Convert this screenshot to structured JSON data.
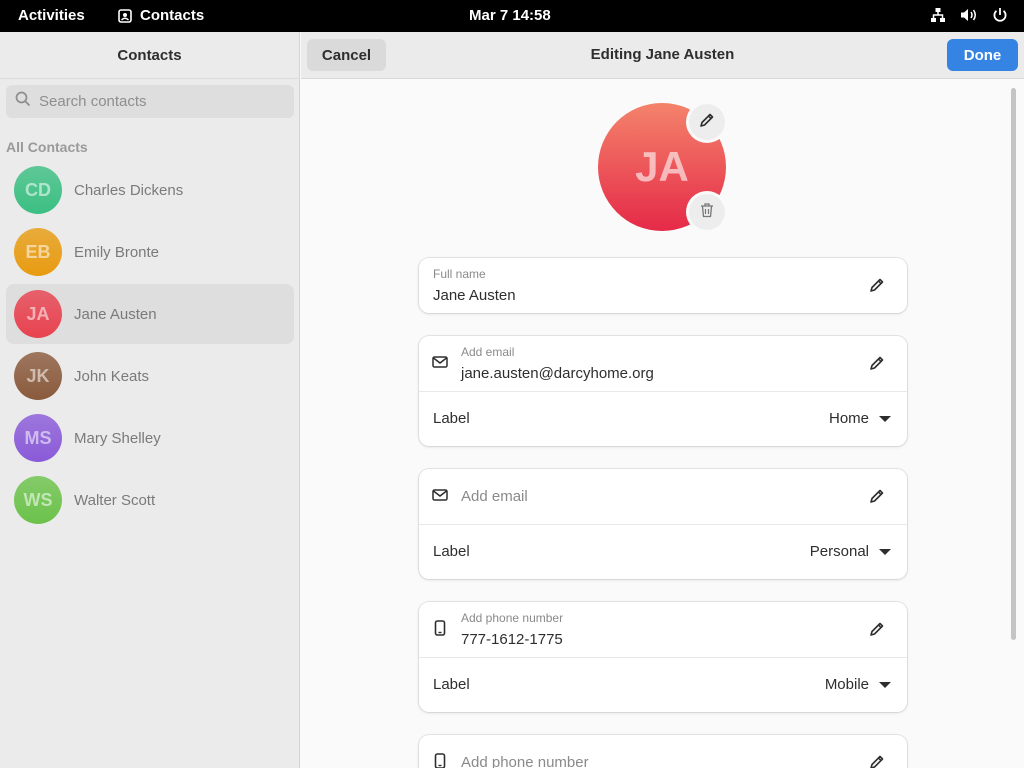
{
  "topbar": {
    "activities": "Activities",
    "app_name": "Contacts",
    "clock": "Mar 7  14:58",
    "icons": [
      "network-icon",
      "volume-icon",
      "power-icon"
    ]
  },
  "sidebar": {
    "title": "Contacts",
    "search_placeholder": "Search contacts",
    "section_label": "All Contacts",
    "contacts": [
      {
        "initials": "CD",
        "name": "Charles Dickens",
        "color": "#3bbf82",
        "selected": false
      },
      {
        "initials": "EB",
        "name": "Emily Bronte",
        "color": "#e89b10",
        "selected": false
      },
      {
        "initials": "JA",
        "name": "Jane Austen",
        "color": "#e8424f",
        "selected": true
      },
      {
        "initials": "JK",
        "name": "John Keats",
        "color": "#8a5a3c",
        "selected": false
      },
      {
        "initials": "MS",
        "name": "Mary Shelley",
        "color": "#8a5ad8",
        "selected": false
      },
      {
        "initials": "WS",
        "name": "Walter Scott",
        "color": "#6bc24a",
        "selected": false
      }
    ]
  },
  "header": {
    "cancel": "Cancel",
    "title": "Editing Jane Austen",
    "done": "Done"
  },
  "editor": {
    "avatar_initials": "JA",
    "full_name": {
      "label": "Full name",
      "value": "Jane Austen"
    },
    "email1": {
      "label": "Add email",
      "value": "jane.austen@darcyhome.org",
      "type_label": "Label",
      "type_value": "Home"
    },
    "email2": {
      "placeholder": "Add email",
      "type_label": "Label",
      "type_value": "Personal"
    },
    "phone1": {
      "label": "Add phone number",
      "value": "777-1612-1775",
      "type_label": "Label",
      "type_value": "Mobile"
    },
    "phone2": {
      "placeholder": "Add phone number"
    }
  },
  "colors": {
    "accent": "#3584e4",
    "avatar_gradient_top": "#f4836b",
    "avatar_gradient_bottom": "#e52a48"
  }
}
